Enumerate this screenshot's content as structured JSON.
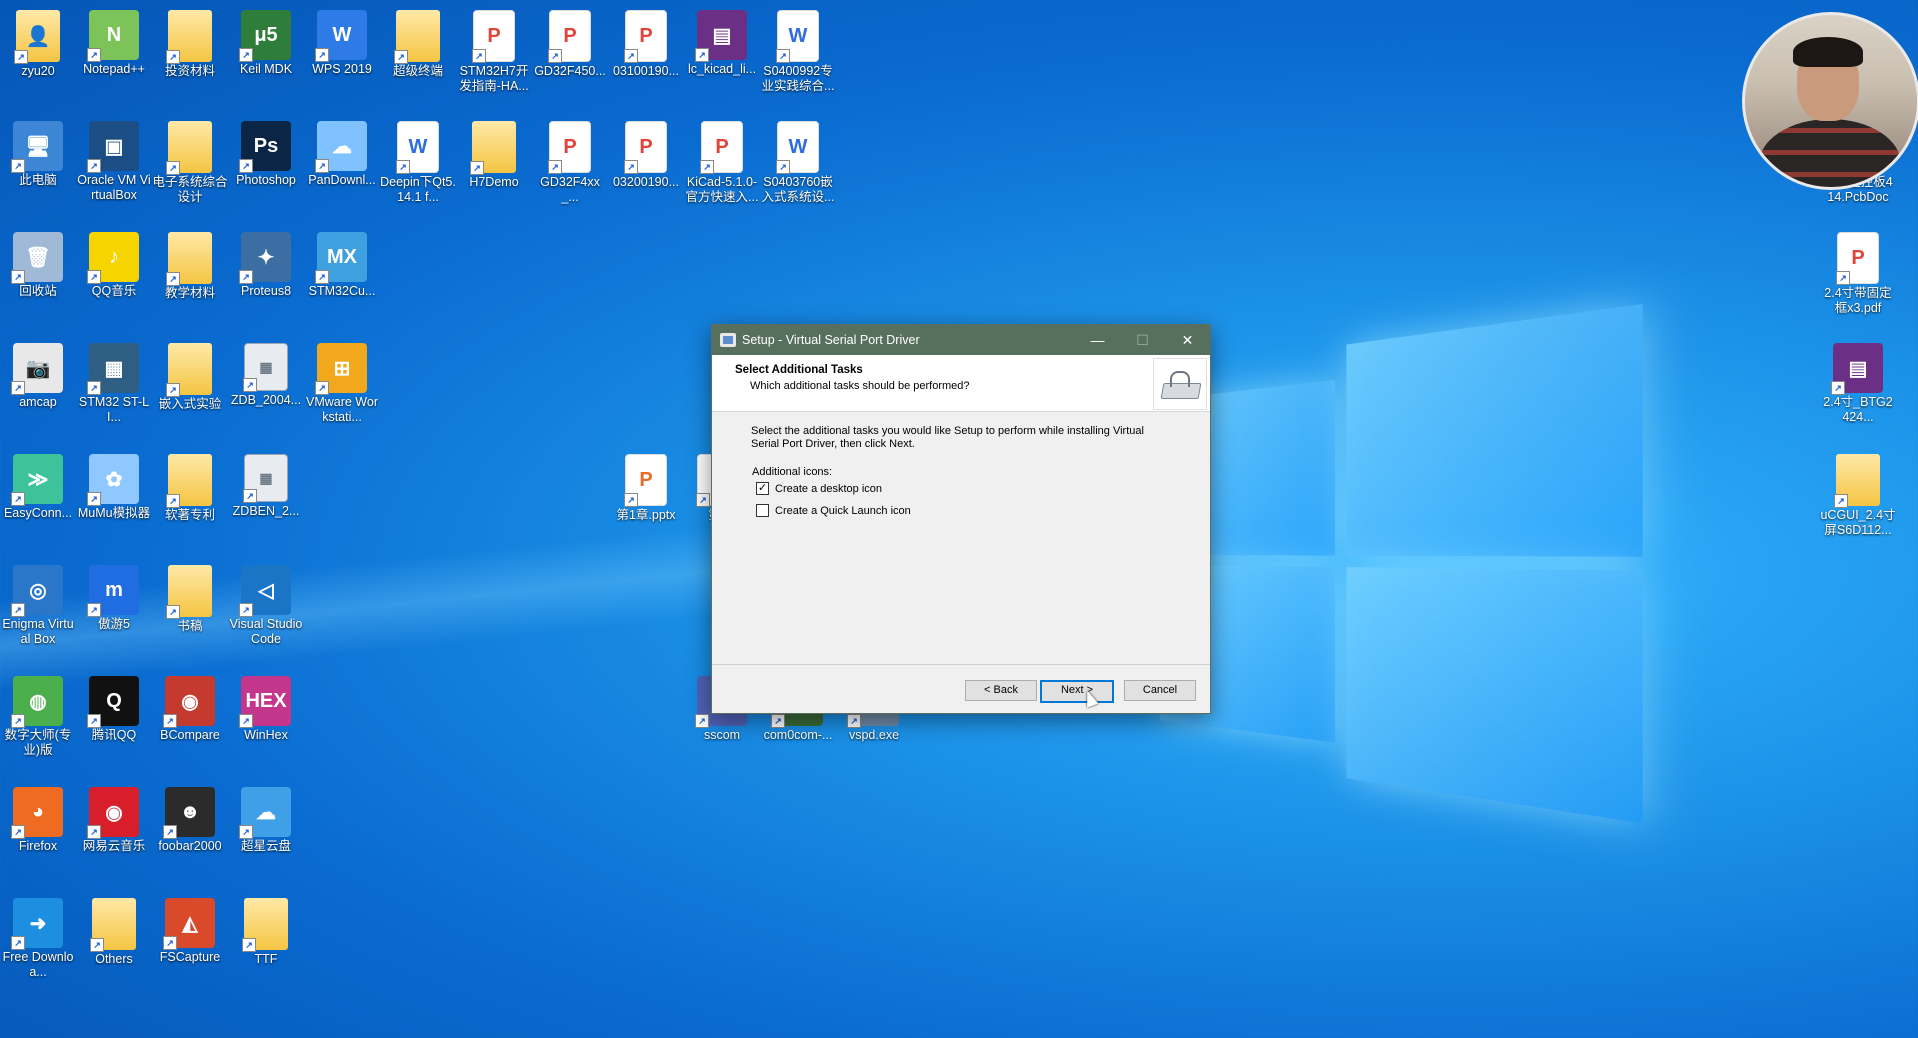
{
  "desktop": {
    "icons": [
      {
        "label": "zyu20",
        "kind": "folder",
        "glyph": "👤"
      },
      {
        "label": "Notepad++",
        "kind": "app",
        "glyph": "N",
        "color": "#7cc45a"
      },
      {
        "label": "投资材料",
        "kind": "folder",
        "glyph": ""
      },
      {
        "label": "Keil MDK",
        "kind": "app",
        "glyph": "μ5",
        "color": "#2f7d3a"
      },
      {
        "label": "WPS 2019",
        "kind": "app",
        "glyph": "W",
        "color": "#2e7ae6"
      },
      {
        "label": "超级终端",
        "kind": "folder",
        "glyph": ""
      },
      {
        "label": "STM32H7开发指南-HA...",
        "kind": "pdf",
        "glyph": "P"
      },
      {
        "label": "GD32F450...",
        "kind": "pdf",
        "glyph": "P"
      },
      {
        "label": "03100190...",
        "kind": "pdf",
        "glyph": "P"
      },
      {
        "label": "lc_kicad_li...",
        "kind": "app",
        "glyph": "▤",
        "color": "#6b2f86"
      },
      {
        "label": "S0400992专业实践综合...",
        "kind": "doc",
        "glyph": "W"
      },
      {
        "label": "此电脑",
        "kind": "app",
        "glyph": "🖥",
        "color": "#3d86d6"
      },
      {
        "label": "Oracle VM VirtualBox",
        "kind": "app",
        "glyph": "▣",
        "color": "#1c4e86"
      },
      {
        "label": "电子系统综合设计",
        "kind": "folder",
        "glyph": ""
      },
      {
        "label": "Photoshop",
        "kind": "app",
        "glyph": "Ps",
        "color": "#0b2547"
      },
      {
        "label": "PanDownl...",
        "kind": "app",
        "glyph": "☁",
        "color": "#7fc2ff"
      },
      {
        "label": "Deepin下Qt5.14.1 f...",
        "kind": "doc",
        "glyph": "W"
      },
      {
        "label": "H7Demo",
        "kind": "folder",
        "glyph": ""
      },
      {
        "label": "GD32F4xx_...",
        "kind": "pdf",
        "glyph": "P"
      },
      {
        "label": "03200190...",
        "kind": "pdf",
        "glyph": "P"
      },
      {
        "label": "KiCad-5.1.0-官方快速入...",
        "kind": "pdf",
        "glyph": "P"
      },
      {
        "label": "S0403760嵌入式系统设...",
        "kind": "doc",
        "glyph": "W"
      },
      {
        "label": "回收站",
        "kind": "app",
        "glyph": "🗑",
        "color": "#9fb9d6"
      },
      {
        "label": "QQ音乐",
        "kind": "app",
        "glyph": "♪",
        "color": "#f5d400"
      },
      {
        "label": "教学材料",
        "kind": "folder",
        "glyph": ""
      },
      {
        "label": "Proteus8",
        "kind": "app",
        "glyph": "✦",
        "color": "#3b6ea3"
      },
      {
        "label": "STM32Cu...",
        "kind": "app",
        "glyph": "MX",
        "color": "#3fa0e0"
      },
      {
        "label": "amcap",
        "kind": "app",
        "glyph": "📷",
        "color": "#e8e8e8"
      },
      {
        "label": "STM32 ST-LI...",
        "kind": "app",
        "glyph": "▦",
        "color": "#2e5f83"
      },
      {
        "label": "嵌入式实验",
        "kind": "folder",
        "glyph": ""
      },
      {
        "label": "ZDB_2004...",
        "kind": "grid",
        "glyph": "▦"
      },
      {
        "label": "VMware Workstati...",
        "kind": "app",
        "glyph": "⊞",
        "color": "#f1a81d"
      },
      {
        "label": "EasyConn...",
        "kind": "app",
        "glyph": "≫",
        "color": "#3dc39a"
      },
      {
        "label": "MuMu模拟器",
        "kind": "app",
        "glyph": "✿",
        "color": "#8fc8ff"
      },
      {
        "label": "软著专利",
        "kind": "folder",
        "glyph": ""
      },
      {
        "label": "ZDBEN_2...",
        "kind": "grid",
        "glyph": "▦"
      },
      {
        "label": "第1章.pptx",
        "kind": "ppt",
        "glyph": "P"
      },
      {
        "label": "第2",
        "kind": "ppt",
        "glyph": "P"
      },
      {
        "label": "Enigma Virtual Box",
        "kind": "app",
        "glyph": "◎",
        "color": "#2a77c9"
      },
      {
        "label": "傲游5",
        "kind": "app",
        "glyph": "m",
        "color": "#1f6de0"
      },
      {
        "label": "书稿",
        "kind": "folder",
        "glyph": ""
      },
      {
        "label": "Visual Studio Code",
        "kind": "app",
        "glyph": "◁",
        "color": "#1b75c6"
      },
      {
        "label": "数字大师(专业)版",
        "kind": "app",
        "glyph": "◍",
        "color": "#4bb04b"
      },
      {
        "label": "腾讯QQ",
        "kind": "app",
        "glyph": "Q",
        "color": "#111111"
      },
      {
        "label": "BCompare",
        "kind": "app",
        "glyph": "◉",
        "color": "#c43a2f"
      },
      {
        "label": "WinHex",
        "kind": "app",
        "glyph": "HEX",
        "color": "#c4358c"
      },
      {
        "label": "sscom",
        "kind": "app",
        "glyph": "▥",
        "color": "#4f63b8"
      },
      {
        "label": "com0com-...",
        "kind": "app",
        "glyph": "▬",
        "color": "#3a6b3a"
      },
      {
        "label": "vspd.exe",
        "kind": "app",
        "glyph": "⚙",
        "color": "#6e8ba8"
      },
      {
        "label": "Firefox",
        "kind": "app",
        "glyph": "◕",
        "color": "#ef6b22"
      },
      {
        "label": "网易云音乐",
        "kind": "app",
        "glyph": "◉",
        "color": "#d81e2a"
      },
      {
        "label": "foobar2000",
        "kind": "app",
        "glyph": "☻",
        "color": "#2b2b2b"
      },
      {
        "label": "超星云盘",
        "kind": "app",
        "glyph": "☁",
        "color": "#3fa0e8"
      },
      {
        "label": "Free Downloa...",
        "kind": "app",
        "glyph": "➜",
        "color": "#1d8fe0"
      },
      {
        "label": "Others",
        "kind": "folder",
        "glyph": ""
      },
      {
        "label": "FSCapture",
        "kind": "app",
        "glyph": "◭",
        "color": "#d84a2a"
      },
      {
        "label": "TTF",
        "kind": "folder",
        "glyph": ""
      },
      {
        "label": "...",
        "kind": "folder",
        "glyph": ""
      },
      {
        "label": "机器主控板414.PcbDoc",
        "kind": "doc",
        "glyph": ""
      },
      {
        "label": "2.4寸带固定框x3.pdf",
        "kind": "pdf",
        "glyph": "P"
      },
      {
        "label": "2.4寸_BTG2424...",
        "kind": "app",
        "glyph": "▤",
        "color": "#6b2f86"
      },
      {
        "label": "uCGUI_2.4寸屏S6D112...",
        "kind": "folder",
        "glyph": ""
      }
    ]
  },
  "dialog": {
    "title": "Setup - Virtual Serial Port Driver",
    "minimize": "—",
    "maximize": "☐",
    "close": "✕",
    "heading": "Select Additional Tasks",
    "subheading": "Which additional tasks should be performed?",
    "instructions": "Select the additional tasks you would like Setup to perform while installing Virtual Serial Port Driver, then click Next.",
    "group_label": "Additional icons:",
    "tasks": [
      {
        "label": "Create a desktop icon",
        "checked": true,
        "mark": "✓"
      },
      {
        "label": "Create a Quick Launch icon",
        "checked": false,
        "mark": ""
      }
    ],
    "buttons": {
      "back": "< Back",
      "next": "Next >",
      "cancel": "Cancel"
    }
  },
  "colors": {
    "titlebar": "#57705e",
    "accent": "#0078d7",
    "desktop": "#0a6bd0"
  }
}
